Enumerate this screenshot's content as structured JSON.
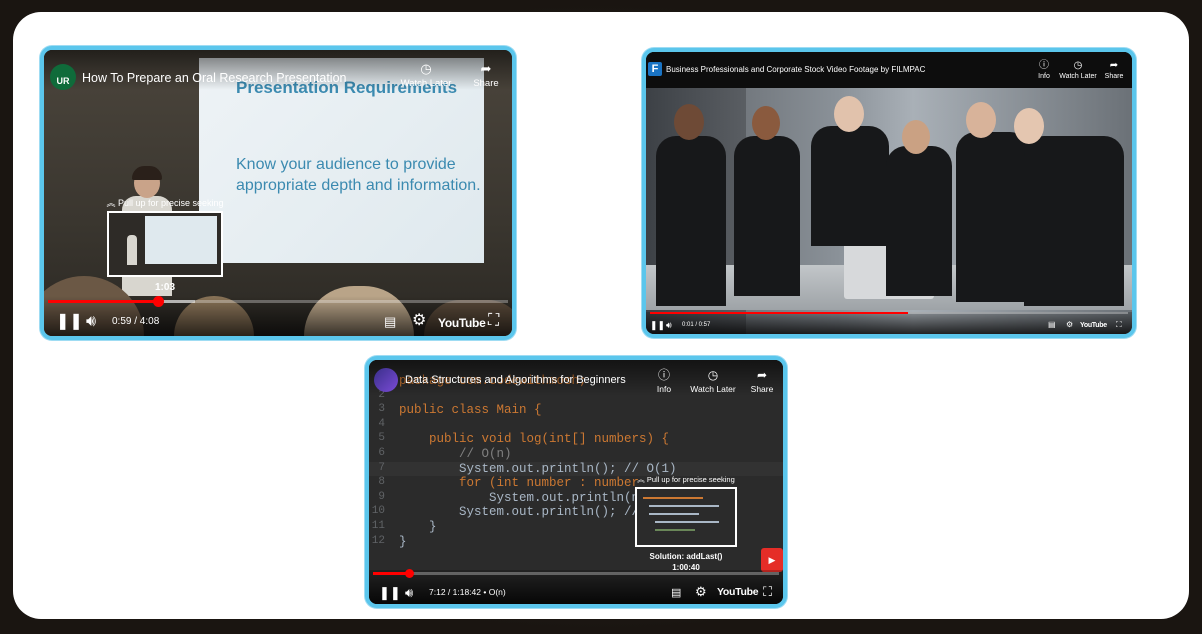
{
  "players": [
    {
      "title": "How To Prepare an Oral Research Presentation",
      "channel_logo_text": "UR",
      "actions": [
        {
          "label": "Watch Later",
          "icon": "clock-icon"
        },
        {
          "label": "Share",
          "icon": "share-icon"
        }
      ],
      "slide_title": "Presentation Requirements",
      "slide_body": "Know your audience to provide\nappropriate depth and information.",
      "seek_hint": "Pull up for precise seeking",
      "seek_time": "1:03",
      "time": "0:59 / 4:08",
      "progress": 0.24,
      "buffered": 0.32,
      "logo": "YouTube"
    },
    {
      "title": "Business Professionals and Corporate Stock Video Footage by FILMPAC",
      "channel_logo_text": "F",
      "actions": [
        {
          "label": "Info",
          "icon": "info-icon"
        },
        {
          "label": "Watch Later",
          "icon": "clock-icon"
        },
        {
          "label": "Share",
          "icon": "share-icon"
        }
      ],
      "time": "0:01 / 0:57",
      "progress": 0.54,
      "logo": "YouTube"
    },
    {
      "title": "Data Structures and Algorithms for Beginners",
      "actions": [
        {
          "label": "Info",
          "icon": "info-icon"
        },
        {
          "label": "Watch Later",
          "icon": "clock-icon"
        },
        {
          "label": "Share",
          "icon": "share-icon"
        }
      ],
      "code_lines": [
        {
          "n": "1",
          "text": "package com.codewithmosh;"
        },
        {
          "n": "2",
          "text": ""
        },
        {
          "n": "3",
          "text": "public class Main {"
        },
        {
          "n": "4",
          "text": ""
        },
        {
          "n": "5",
          "text": "    public void log(int[] numbers) {"
        },
        {
          "n": "6",
          "text": "        // O(n)"
        },
        {
          "n": "7",
          "text": "        System.out.println(); // O(1)"
        },
        {
          "n": "8",
          "text": "        for (int number : number"
        },
        {
          "n": "9",
          "text": "            System.out.println(n"
        },
        {
          "n": "10",
          "text": "        System.out.println(); //"
        },
        {
          "n": "11",
          "text": "    }"
        },
        {
          "n": "12",
          "text": "}"
        }
      ],
      "seek_hint": "Pull up for precise seeking",
      "chapter": "Solution: addLast()",
      "seek_time": "1:00:40",
      "time": "7:12 / 1:18:42",
      "chapter_inline": "O(n)",
      "progress": 0.09,
      "logo": "YouTube"
    }
  ],
  "colors": {
    "border": "#5bc6ec",
    "progress": "#ff0000"
  }
}
